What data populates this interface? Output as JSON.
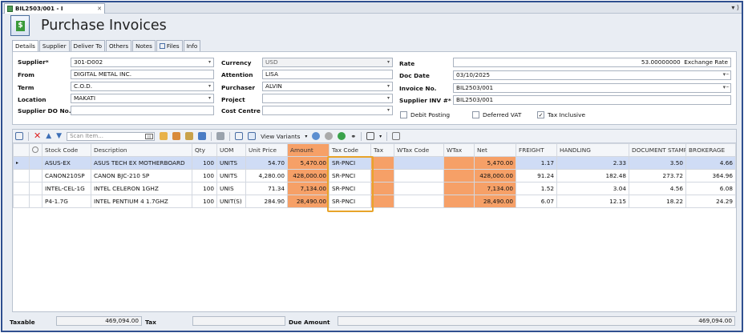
{
  "tab": {
    "title": "BIL2503/001 - I",
    "close": "✕"
  },
  "window_controls": "▾ ⟩",
  "title": "Purchase Invoices",
  "subtabs": [
    "Details",
    "Supplier",
    "Deliver To",
    "Others",
    "Notes",
    "Files",
    "Info"
  ],
  "form": {
    "supplier_label": "Supplier*",
    "supplier": "301-D002",
    "from_label": "From",
    "from": "DIGITAL METAL  INC.",
    "term_label": "Term",
    "term": "C.O.D.",
    "location_label": "Location",
    "location": "MAKATI",
    "supplier_do_label": "Supplier DO No.",
    "supplier_do": "",
    "currency_label": "Currency",
    "currency": "USD",
    "attention_label": "Attention",
    "attention": "LISA",
    "purchaser_label": "Purchaser",
    "purchaser": "ALVIN",
    "project_label": "Project",
    "project": "",
    "cost_centre_label": "Cost Centre",
    "cost_centre": "",
    "rate_label": "Rate",
    "rate": "53.00000000",
    "rate_suffix": "Exchange Rate",
    "doc_date_label": "Doc Date",
    "doc_date": "03/10/2025",
    "invoice_no_label": "Invoice No.",
    "invoice_no": "BIL2503/001",
    "supplier_inv_label": "Supplier INV #*",
    "supplier_inv": "BIL2503/001",
    "debit_posting_label": "Debit Posting",
    "deferred_vat_label": "Deferred VAT",
    "tax_inclusive_label": "Tax Inclusive"
  },
  "toolbar": {
    "scan_placeholder": "Scan Item...",
    "view_variants": "View Variants"
  },
  "columns": [
    "Stock Code",
    "Description",
    "Qty",
    "UOM",
    "Unit Price",
    "Amount",
    "Tax Code",
    "Tax",
    "WTax Code",
    "WTax",
    "Net",
    "FREIGHT",
    "HANDLING",
    "DOCUMENT STAMP",
    "BROKERAGE"
  ],
  "rows": [
    [
      "ASUS-EX",
      "ASUS TECH EX MOTHERBOARD",
      "100",
      "UNITS",
      "54.70",
      "5,470.00",
      "SR-PNCI",
      "",
      "",
      "",
      "5,470.00",
      "1.17",
      "2.33",
      "3.50",
      "4.66"
    ],
    [
      "CANON210SP",
      "CANON BJC-210 SP",
      "100",
      "UNITS",
      "4,280.00",
      "428,000.00",
      "SR-PNCI",
      "",
      "",
      "",
      "428,000.00",
      "91.24",
      "182.48",
      "273.72",
      "364.96"
    ],
    [
      "INTEL-CEL-1G",
      "INTEL CELERON 1GHZ",
      "100",
      "UNIS",
      "71.34",
      "7,134.00",
      "SR-PNCI",
      "",
      "",
      "",
      "7,134.00",
      "1.52",
      "3.04",
      "4.56",
      "6.08"
    ],
    [
      "P4-1.7G",
      "INTEL PENTIUM 4 1.7GHZ",
      "100",
      "UNIT(S)",
      "284.90",
      "28,490.00",
      "SR-PNCI",
      "",
      "",
      "",
      "28,490.00",
      "6.07",
      "12.15",
      "18.22",
      "24.29"
    ]
  ],
  "footer": {
    "taxable_label": "Taxable",
    "taxable": "469,094.00",
    "tax_label": "Tax",
    "tax": "",
    "due_label": "Due Amount",
    "due": "469,094.00"
  },
  "colors": {
    "highlight_column": "#f6a067",
    "selected_row": "#cfdcf5",
    "tax_code_outline": "#e8a42a"
  }
}
